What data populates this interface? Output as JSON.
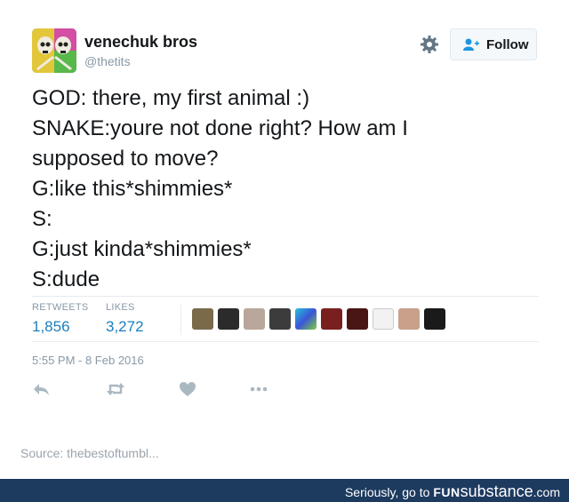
{
  "user": {
    "display_name": "venechuk bros",
    "handle": "@thetits"
  },
  "header": {
    "follow_label": "Follow",
    "settings_icon": "gear-icon"
  },
  "tweet": {
    "lines": [
      "GOD: there, my first animal :)",
      "SNAKE:youre not done right? How am I",
      "supposed to move?",
      "G:like this*shimmies*",
      "S:",
      "G:just kinda*shimmies*",
      "S:dude"
    ]
  },
  "stats": {
    "retweets_label": "RETWEETS",
    "retweets": "1,856",
    "likes_label": "LIKES",
    "likes": "3,272"
  },
  "timestamp": "5:55 PM - 8 Feb 2016",
  "actions": [
    "reply-icon",
    "retweet-icon",
    "like-icon",
    "more-icon"
  ],
  "source": "Source: thebestoftumbl...",
  "footer": {
    "prefix": "Seriously, go to ",
    "brand_bold": "FUN",
    "brand_rest": "substance",
    "suffix": ".com"
  },
  "colors": {
    "link": "#1b7fbf",
    "muted": "#8899a6",
    "footer_bg": "#1d3a5f"
  }
}
